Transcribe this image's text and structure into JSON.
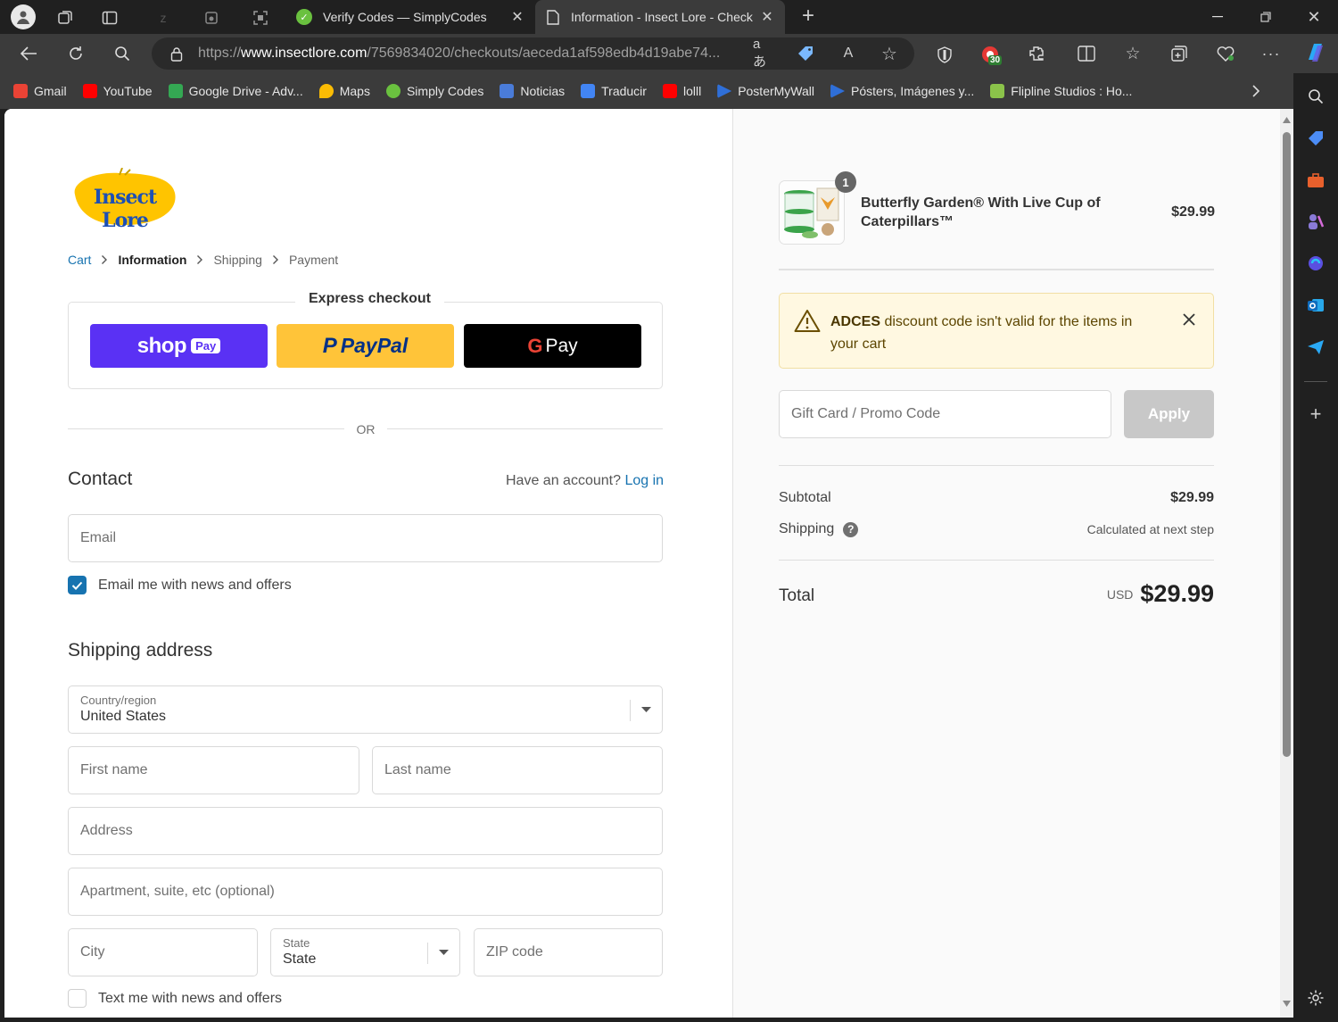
{
  "browser": {
    "tabs": [
      {
        "label": "Verify Codes — SimplyCodes"
      },
      {
        "label": "Information - Insect Lore - Check"
      }
    ],
    "url_prefix": "https://",
    "url_domain": "www.insectlore.com",
    "url_path": "/7569834020/checkouts/aeceda1af598edb4d19abe74...",
    "extension_badge": "30",
    "bookmarks": [
      {
        "label": "Gmail",
        "color": "#ea4335"
      },
      {
        "label": "YouTube",
        "color": "#ff0000"
      },
      {
        "label": "Google Drive - Adv...",
        "color": "#34a853"
      },
      {
        "label": "Maps",
        "color": "#fbbc04"
      },
      {
        "label": "Simply Codes",
        "color": "#6ac13f"
      },
      {
        "label": "Noticias",
        "color": "#4a7cd9"
      },
      {
        "label": "Traducir",
        "color": "#4285f4"
      },
      {
        "label": "lolll",
        "color": "#ff0000"
      },
      {
        "label": "PosterMyWall",
        "color": "#2f6fd8"
      },
      {
        "label": "Pósters, Imágenes y...",
        "color": "#2f6fd8"
      },
      {
        "label": "Flipline Studios : Ho...",
        "color": "#8bc34a"
      }
    ]
  },
  "checkout": {
    "logo_text": "Insect Lore",
    "breadcrumb": {
      "cart": "Cart",
      "information": "Information",
      "shipping": "Shipping",
      "payment": "Payment"
    },
    "express_title": "Express checkout",
    "shop_label": "shop",
    "shop_pay": "Pay",
    "paypal_p": "P",
    "paypal_label": "PayPal",
    "gpay_g": "G",
    "gpay_label": "Pay",
    "or": "OR",
    "contact_title": "Contact",
    "have_account": "Have an account?",
    "login": "Log in",
    "email_placeholder": "Email",
    "email_news": "Email me with news and offers",
    "shipping_title": "Shipping address",
    "country_label": "Country/region",
    "country_value": "United States",
    "first_name": "First name",
    "last_name": "Last name",
    "address": "Address",
    "apartment": "Apartment, suite, etc (optional)",
    "city": "City",
    "state_label": "State",
    "state_value": "State",
    "zip": "ZIP code",
    "text_news": "Text me with news and offers"
  },
  "summary": {
    "qty": "1",
    "product_name": "Butterfly Garden® With Live Cup of Caterpillars™",
    "product_price": "$29.99",
    "alert_code": "ADCES",
    "alert_rest": " discount code isn't valid for the items in your cart",
    "promo_placeholder": "Gift Card / Promo Code",
    "apply": "Apply",
    "subtotal_label": "Subtotal",
    "subtotal_value": "$29.99",
    "shipping_label": "Shipping",
    "shipping_value": "Calculated at next step",
    "total_label": "Total",
    "currency": "USD",
    "total_value": "$29.99"
  }
}
